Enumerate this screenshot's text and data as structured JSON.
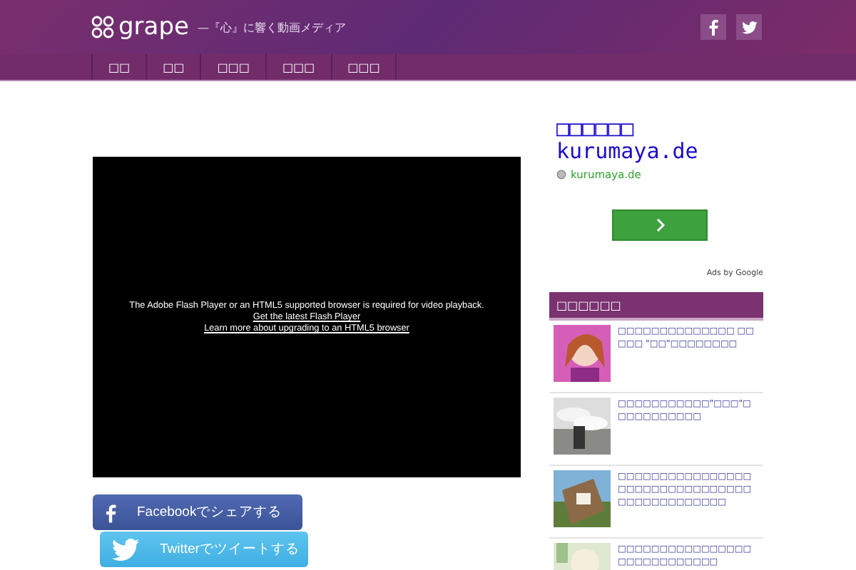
{
  "header": {
    "logo": "grape",
    "tagline": "—『心』に響く動画メディア"
  },
  "nav": {
    "items": [
      {
        "label": "□□"
      },
      {
        "label": "□□"
      },
      {
        "label": "□□□"
      },
      {
        "label": "□□□"
      },
      {
        "label": "□□□"
      }
    ]
  },
  "video": {
    "message": "The Adobe Flash Player or an HTML5 supported browser is required for video playback.",
    "links": [
      "Get the latest Flash Player",
      "Learn more about upgrading to an HTML5 browser"
    ]
  },
  "share": [
    {
      "kind": "facebook",
      "label": "Facebookでシェアする"
    },
    {
      "kind": "twitter",
      "label": "Twitterでツイートする"
    }
  ],
  "ad": {
    "title": "□□□□□□",
    "domain_large": "kurumaya.de",
    "domain": "kurumaya.de",
    "attribution": "Ads by Google"
  },
  "sidebar": {
    "heading": "□□□□□□",
    "articles": [
      {
        "title": "□□□□□□□□□□□□□□ □□□□□ \"□□\"□□□□□□□□",
        "kind": "picture"
      },
      {
        "title": "□□□□□□□□□□□\"□□□\"□□□□□□□□□□□",
        "kind": "picture"
      },
      {
        "title": "□□□□□□□□□□□□□□□□□□□□□□□□□□□□□□□□□□□□□□□□□□□□□",
        "kind": "picture"
      },
      {
        "title": "□□□□□□□□□□□□□□□□□□□□□□□□□□□□",
        "kind": "picture"
      }
    ]
  }
}
